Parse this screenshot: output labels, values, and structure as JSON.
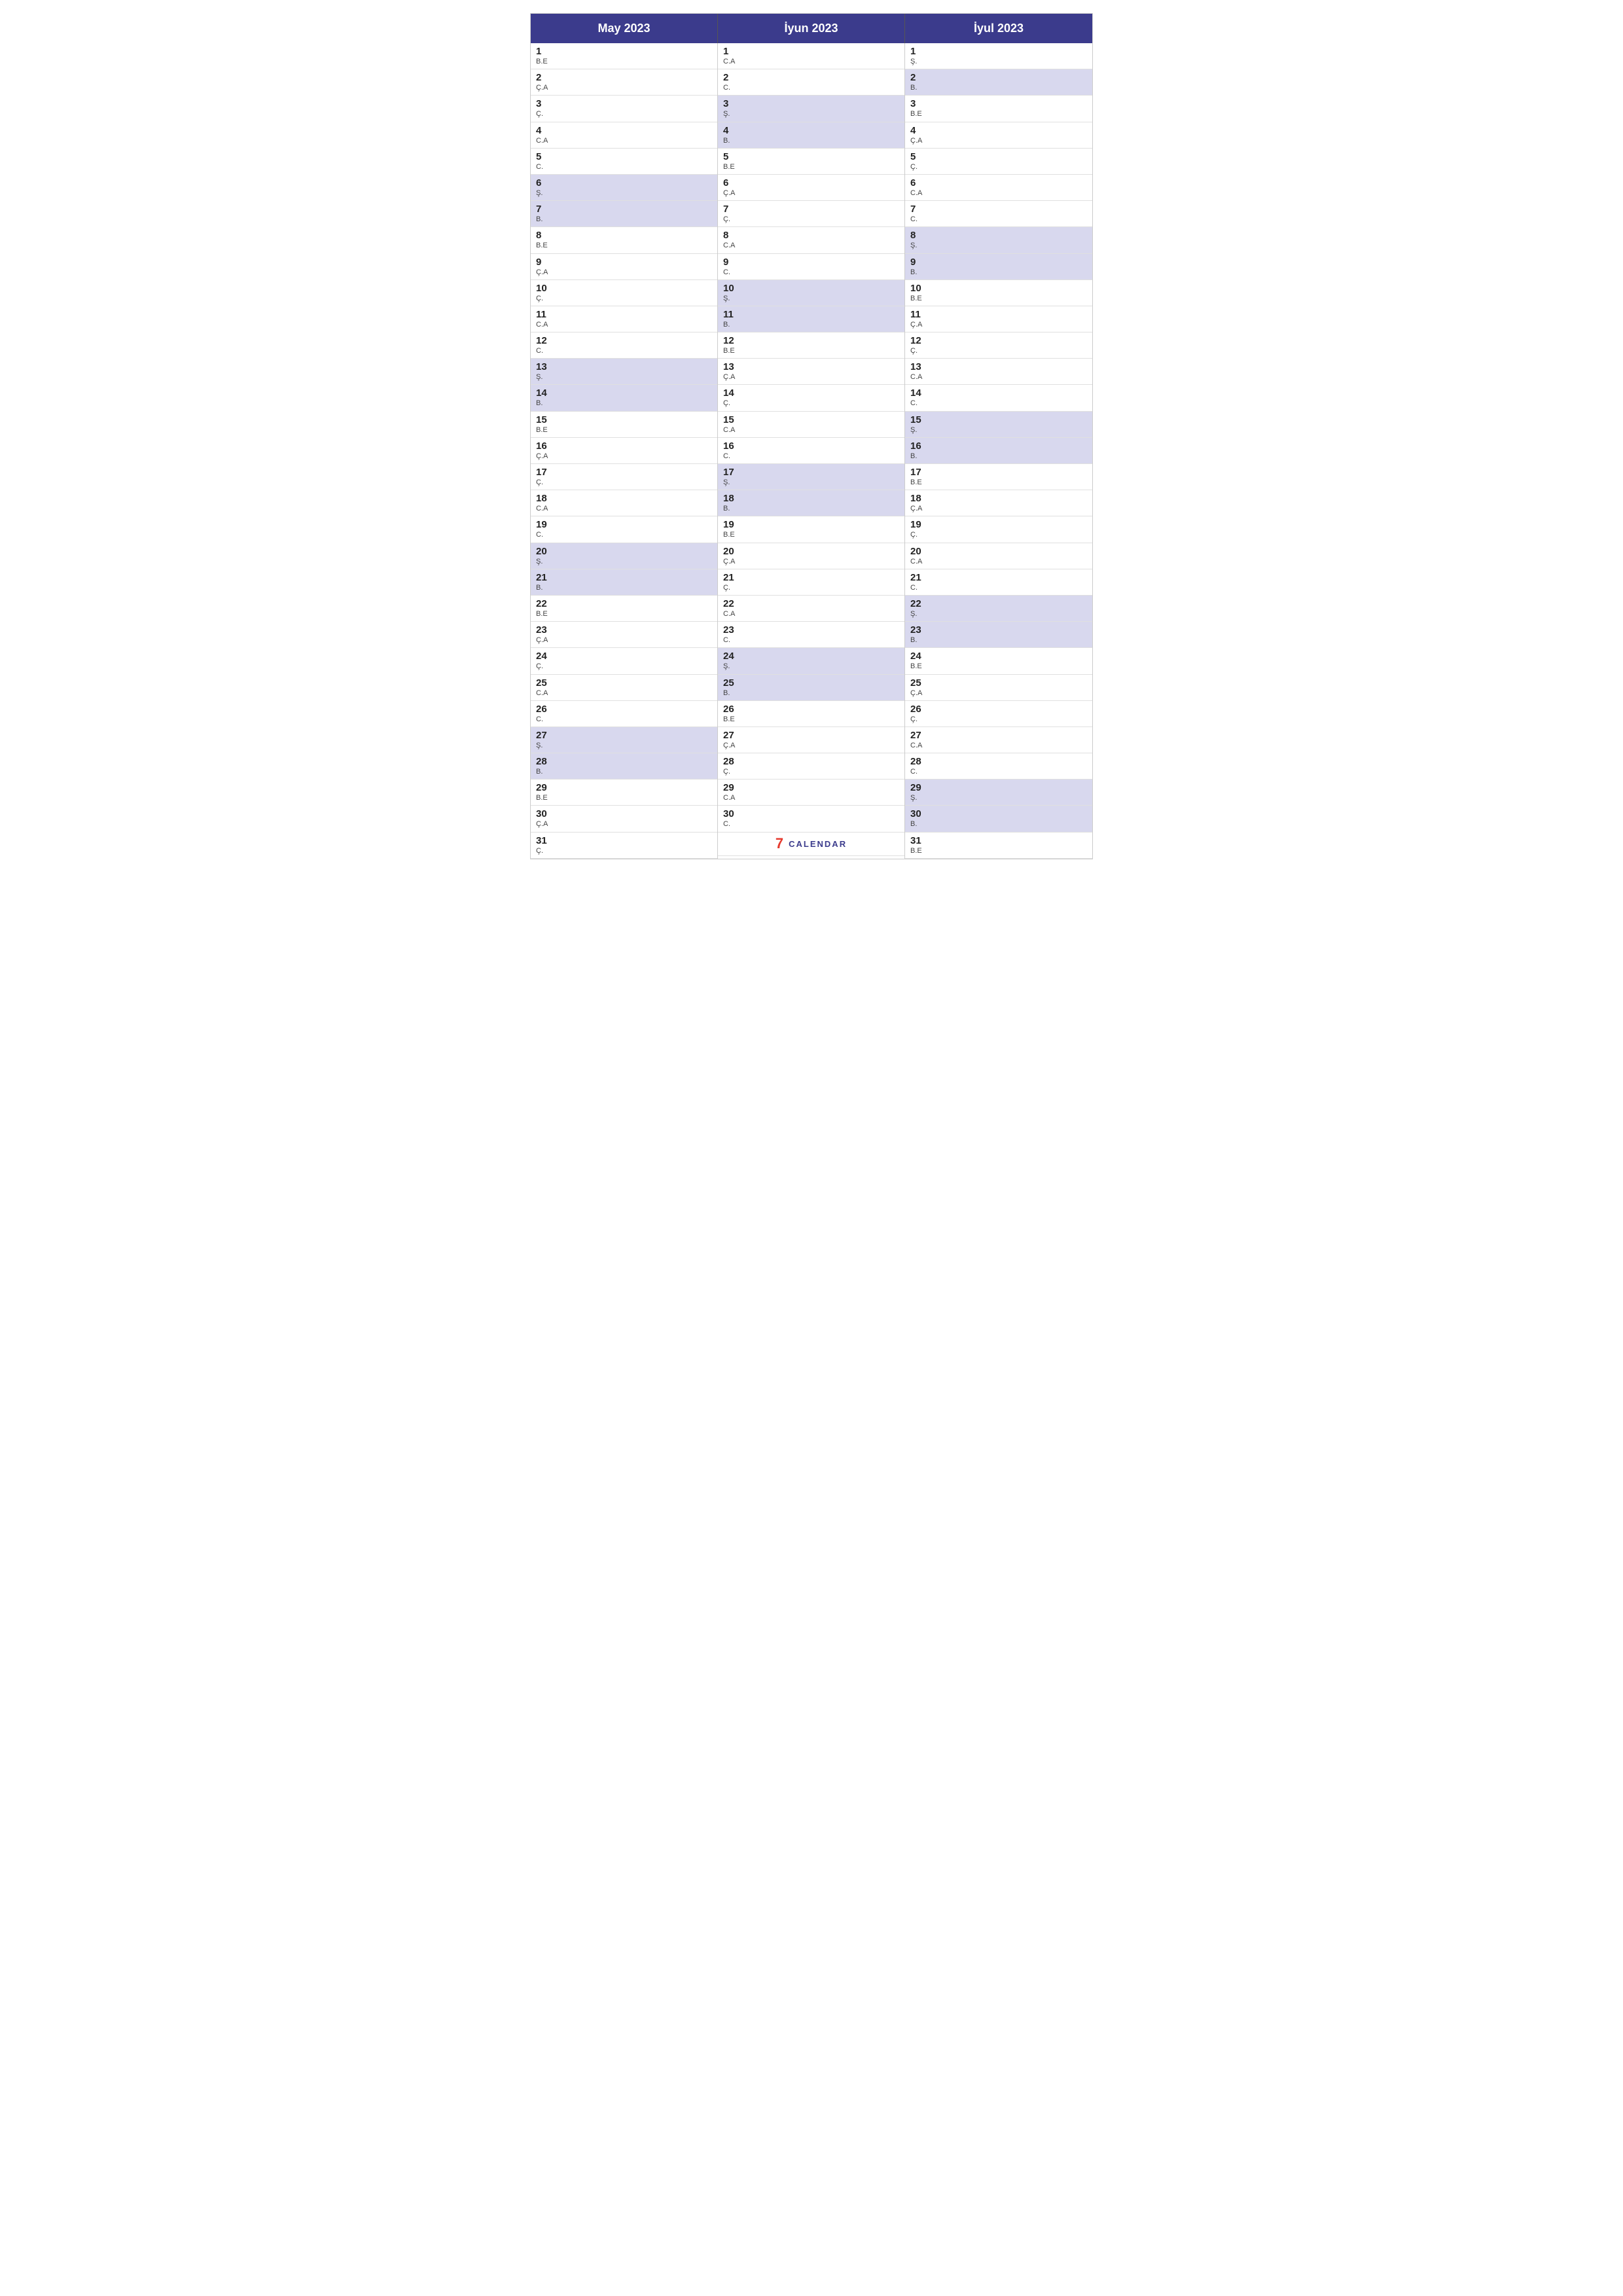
{
  "months": [
    {
      "name": "May 2023",
      "days": [
        {
          "num": "1",
          "abbr": "B.E",
          "hl": false
        },
        {
          "num": "2",
          "abbr": "Ç.A",
          "hl": false
        },
        {
          "num": "3",
          "abbr": "Ç.",
          "hl": false
        },
        {
          "num": "4",
          "abbr": "C.A",
          "hl": false
        },
        {
          "num": "5",
          "abbr": "C.",
          "hl": false
        },
        {
          "num": "6",
          "abbr": "Ş.",
          "hl": true
        },
        {
          "num": "7",
          "abbr": "B.",
          "hl": true
        },
        {
          "num": "8",
          "abbr": "B.E",
          "hl": false
        },
        {
          "num": "9",
          "abbr": "Ç.A",
          "hl": false
        },
        {
          "num": "10",
          "abbr": "Ç.",
          "hl": false
        },
        {
          "num": "11",
          "abbr": "C.A",
          "hl": false
        },
        {
          "num": "12",
          "abbr": "C.",
          "hl": false
        },
        {
          "num": "13",
          "abbr": "Ş.",
          "hl": true
        },
        {
          "num": "14",
          "abbr": "B.",
          "hl": true
        },
        {
          "num": "15",
          "abbr": "B.E",
          "hl": false
        },
        {
          "num": "16",
          "abbr": "Ç.A",
          "hl": false
        },
        {
          "num": "17",
          "abbr": "Ç.",
          "hl": false
        },
        {
          "num": "18",
          "abbr": "C.A",
          "hl": false
        },
        {
          "num": "19",
          "abbr": "C.",
          "hl": false
        },
        {
          "num": "20",
          "abbr": "Ş.",
          "hl": true
        },
        {
          "num": "21",
          "abbr": "B.",
          "hl": true
        },
        {
          "num": "22",
          "abbr": "B.E",
          "hl": false
        },
        {
          "num": "23",
          "abbr": "Ç.A",
          "hl": false
        },
        {
          "num": "24",
          "abbr": "Ç.",
          "hl": false
        },
        {
          "num": "25",
          "abbr": "C.A",
          "hl": false
        },
        {
          "num": "26",
          "abbr": "C.",
          "hl": false
        },
        {
          "num": "27",
          "abbr": "Ş.",
          "hl": true
        },
        {
          "num": "28",
          "abbr": "B.",
          "hl": true
        },
        {
          "num": "29",
          "abbr": "B.E",
          "hl": false
        },
        {
          "num": "30",
          "abbr": "Ç.A",
          "hl": false
        },
        {
          "num": "31",
          "abbr": "Ç.",
          "hl": false
        }
      ]
    },
    {
      "name": "İyun 2023",
      "days": [
        {
          "num": "1",
          "abbr": "C.A",
          "hl": false
        },
        {
          "num": "2",
          "abbr": "C.",
          "hl": false
        },
        {
          "num": "3",
          "abbr": "Ş.",
          "hl": true
        },
        {
          "num": "4",
          "abbr": "B.",
          "hl": true
        },
        {
          "num": "5",
          "abbr": "B.E",
          "hl": false
        },
        {
          "num": "6",
          "abbr": "Ç.A",
          "hl": false
        },
        {
          "num": "7",
          "abbr": "Ç.",
          "hl": false
        },
        {
          "num": "8",
          "abbr": "C.A",
          "hl": false
        },
        {
          "num": "9",
          "abbr": "C.",
          "hl": false
        },
        {
          "num": "10",
          "abbr": "Ş.",
          "hl": true
        },
        {
          "num": "11",
          "abbr": "B.",
          "hl": true
        },
        {
          "num": "12",
          "abbr": "B.E",
          "hl": false
        },
        {
          "num": "13",
          "abbr": "Ç.A",
          "hl": false
        },
        {
          "num": "14",
          "abbr": "Ç.",
          "hl": false
        },
        {
          "num": "15",
          "abbr": "C.A",
          "hl": false
        },
        {
          "num": "16",
          "abbr": "C.",
          "hl": false
        },
        {
          "num": "17",
          "abbr": "Ş.",
          "hl": true
        },
        {
          "num": "18",
          "abbr": "B.",
          "hl": true
        },
        {
          "num": "19",
          "abbr": "B.E",
          "hl": false
        },
        {
          "num": "20",
          "abbr": "Ç.A",
          "hl": false
        },
        {
          "num": "21",
          "abbr": "Ç.",
          "hl": false
        },
        {
          "num": "22",
          "abbr": "C.A",
          "hl": false
        },
        {
          "num": "23",
          "abbr": "C.",
          "hl": false
        },
        {
          "num": "24",
          "abbr": "Ş.",
          "hl": true
        },
        {
          "num": "25",
          "abbr": "B.",
          "hl": true
        },
        {
          "num": "26",
          "abbr": "B.E",
          "hl": false
        },
        {
          "num": "27",
          "abbr": "Ç.A",
          "hl": false
        },
        {
          "num": "28",
          "abbr": "Ç.",
          "hl": false
        },
        {
          "num": "29",
          "abbr": "C.A",
          "hl": false
        },
        {
          "num": "30",
          "abbr": "C.",
          "hl": false
        }
      ]
    },
    {
      "name": "İyul 2023",
      "days": [
        {
          "num": "1",
          "abbr": "Ş.",
          "hl": false
        },
        {
          "num": "2",
          "abbr": "B.",
          "hl": true
        },
        {
          "num": "3",
          "abbr": "B.E",
          "hl": false
        },
        {
          "num": "4",
          "abbr": "Ç.A",
          "hl": false
        },
        {
          "num": "5",
          "abbr": "Ç.",
          "hl": false
        },
        {
          "num": "6",
          "abbr": "C.A",
          "hl": false
        },
        {
          "num": "7",
          "abbr": "C.",
          "hl": false
        },
        {
          "num": "8",
          "abbr": "Ş.",
          "hl": true
        },
        {
          "num": "9",
          "abbr": "B.",
          "hl": true
        },
        {
          "num": "10",
          "abbr": "B.E",
          "hl": false
        },
        {
          "num": "11",
          "abbr": "Ç.A",
          "hl": false
        },
        {
          "num": "12",
          "abbr": "Ç.",
          "hl": false
        },
        {
          "num": "13",
          "abbr": "C.A",
          "hl": false
        },
        {
          "num": "14",
          "abbr": "C.",
          "hl": false
        },
        {
          "num": "15",
          "abbr": "Ş.",
          "hl": true
        },
        {
          "num": "16",
          "abbr": "B.",
          "hl": true
        },
        {
          "num": "17",
          "abbr": "B.E",
          "hl": false
        },
        {
          "num": "18",
          "abbr": "Ç.A",
          "hl": false
        },
        {
          "num": "19",
          "abbr": "Ç.",
          "hl": false
        },
        {
          "num": "20",
          "abbr": "C.A",
          "hl": false
        },
        {
          "num": "21",
          "abbr": "C.",
          "hl": false
        },
        {
          "num": "22",
          "abbr": "Ş.",
          "hl": true
        },
        {
          "num": "23",
          "abbr": "B.",
          "hl": true
        },
        {
          "num": "24",
          "abbr": "B.E",
          "hl": false
        },
        {
          "num": "25",
          "abbr": "Ç.A",
          "hl": false
        },
        {
          "num": "26",
          "abbr": "Ç.",
          "hl": false
        },
        {
          "num": "27",
          "abbr": "C.A",
          "hl": false
        },
        {
          "num": "28",
          "abbr": "C.",
          "hl": false
        },
        {
          "num": "29",
          "abbr": "Ş.",
          "hl": true
        },
        {
          "num": "30",
          "abbr": "B.",
          "hl": true
        },
        {
          "num": "31",
          "abbr": "B.E",
          "hl": false
        }
      ]
    }
  ],
  "logo": {
    "icon": "7",
    "text": "CALENDAR"
  }
}
